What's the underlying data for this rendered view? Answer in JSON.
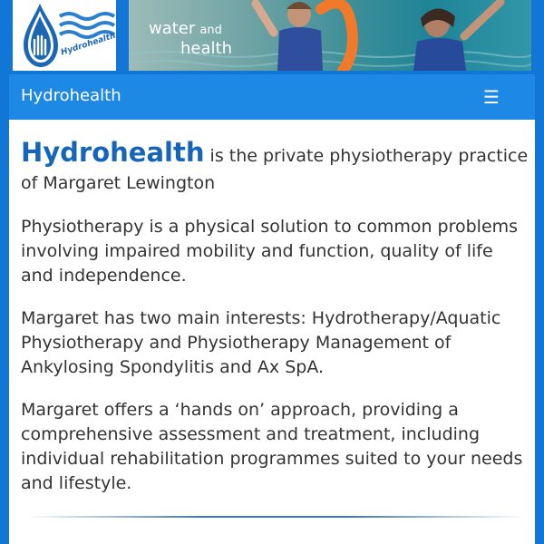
{
  "banner": {
    "logo_text": "Hydrohealth",
    "tagline_line1": "water",
    "tagline_and": "and",
    "tagline_line2": "health",
    "logo_icon": "water-drop-hands-icon",
    "photo": "aquatic-therapy-photo"
  },
  "navbar": {
    "brand": "Hydrohealth",
    "menu_icon": "☰"
  },
  "content": {
    "intro_brand": "Hydrohealth",
    "intro_rest": " is the private physiotherapy practice of Margaret Lewington",
    "paragraphs": [
      "Physiotherapy is a physical solution to common problems involving impaired mobility and function, quality of life and independence.",
      "Margaret has two main interests: Hydrotherapy/Aquatic Physiotherapy and Physiotherapy Management of Ankylosing Spondylitis and Ax SpA.",
      "Margaret offers a ‘hands on’ approach, providing a comprehensive assessment and treatment, including individual rehabilitation programmes suited to your needs and lifestyle."
    ]
  },
  "colors": {
    "brand_blue": "#1e88e5",
    "heading_blue": "#1565b8",
    "text": "#333333"
  }
}
